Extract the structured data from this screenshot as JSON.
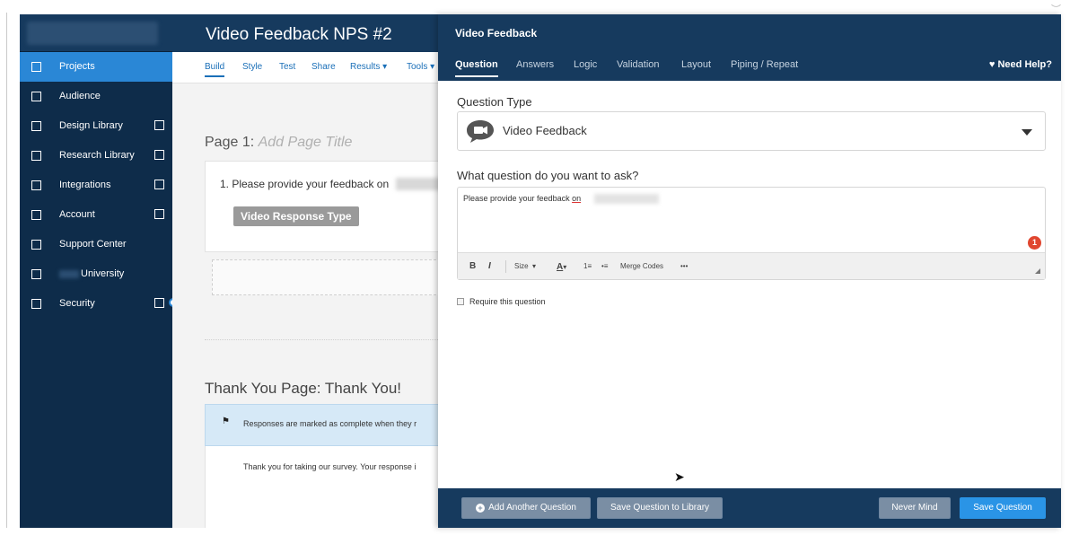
{
  "sidebar": {
    "items": [
      {
        "label": "Projects",
        "active": true
      },
      {
        "label": "Audience"
      },
      {
        "label": "Design Library"
      },
      {
        "label": "Research Library"
      },
      {
        "label": "Integrations"
      },
      {
        "label": "Account"
      },
      {
        "label": "Support Center"
      },
      {
        "label": "University"
      },
      {
        "label": "Security"
      }
    ]
  },
  "survey": {
    "title": "Video Feedback NPS #2",
    "nav": [
      "Build",
      "Style",
      "Test",
      "Share",
      "Results ▾",
      "Tools ▾"
    ],
    "page_label": "Page 1:",
    "page_title_placeholder": "Add Page Title",
    "question_text": "1. Please provide your feedback on",
    "response_type_badge": "Video Response Type",
    "thank_you_title": "Thank You Page: Thank You!",
    "thank_you_note": "Responses are marked as complete when they r",
    "thank_you_body": "Thank you for taking our survey. Your response i"
  },
  "panel": {
    "title": "Video Feedback",
    "tabs": [
      "Question",
      "Answers",
      "Logic",
      "Validation",
      "Layout",
      "Piping / Repeat"
    ],
    "active_tab": "Question",
    "need_help": "Need Help?",
    "question_type_label": "Question Type",
    "question_type_value": "Video Feedback",
    "ask_label": "What question do you want to ask?",
    "editor_text": "Please provide your feedback",
    "editor_text_underlined": "on",
    "error_count": "1",
    "toolbar": {
      "bold": "B",
      "italic": "I",
      "size": "Size",
      "size_caret": "▾",
      "font_color": "A",
      "font_color_caret": "▾",
      "numbered_list": "1≡",
      "bullet_list": "•≡",
      "merge_codes": "Merge Codes",
      "more": "•••"
    },
    "require_label": "Require this question",
    "footer": {
      "add_another": "Add Another Question",
      "add_icon": "+",
      "save_to_library": "Save Question to Library",
      "never_mind": "Never Mind",
      "save_question": "Save Question"
    }
  },
  "colors": {
    "sidebar_bg": "#0e2c4a",
    "header_bg": "#163a5e",
    "accent": "#2a87d6",
    "save_button": "#2a94e6",
    "error_badge": "#e0462f"
  }
}
